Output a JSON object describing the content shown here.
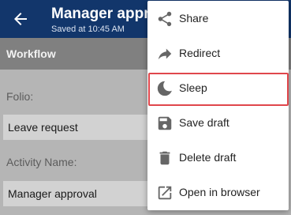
{
  "appbar": {
    "title": "Manager approval",
    "subtitle": "Saved at 10:45 AM",
    "back_icon": "arrow-back-icon"
  },
  "section": {
    "title": "Workflow"
  },
  "form": {
    "folio_label": "Folio:",
    "folio_value": "Leave request",
    "activity_label": "Activity Name:",
    "activity_value": "Manager approval"
  },
  "menu": {
    "items": [
      {
        "label": "Share",
        "icon": "share-icon"
      },
      {
        "label": "Redirect",
        "icon": "redirect-arrow-icon"
      },
      {
        "label": "Sleep",
        "icon": "moon-icon",
        "highlighted": true
      },
      {
        "label": "Save draft",
        "icon": "save-icon"
      },
      {
        "label": "Delete draft",
        "icon": "trash-icon"
      },
      {
        "label": "Open in browser",
        "icon": "open-external-icon"
      }
    ]
  },
  "colors": {
    "appbar": "#12366b",
    "highlight": "#e0474c",
    "icon": "#666666"
  }
}
